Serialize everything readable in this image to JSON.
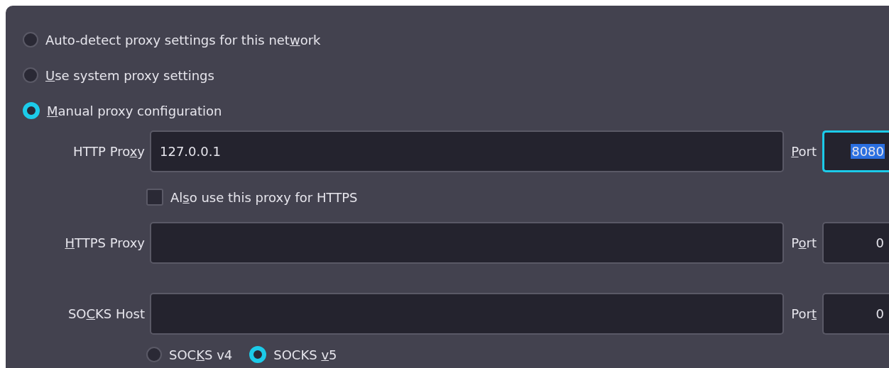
{
  "proxy_options": [
    {
      "label": {
        "before": "Auto-detect proxy settings for this net",
        "key": "w",
        "after": "ork"
      },
      "selected": false
    },
    {
      "label": {
        "key": "U",
        "after": "se system proxy settings"
      },
      "selected": false
    },
    {
      "label": {
        "key": "M",
        "after": "anual proxy configuration"
      },
      "selected": true
    }
  ],
  "http": {
    "label": {
      "before": "HTTP Pro",
      "key": "x",
      "after": "y"
    },
    "value": "127.0.0.1",
    "port_label": {
      "key": "P",
      "after": "ort"
    },
    "port": "8080",
    "port_focused": true,
    "port_text_selected": true
  },
  "also_https": {
    "label": {
      "before": "Al",
      "key": "s",
      "after": "o use this proxy for HTTPS"
    },
    "checked": false
  },
  "https": {
    "label": {
      "key": "H",
      "after": "TTPS Proxy"
    },
    "port_label": {
      "before": "P",
      "key": "o",
      "after": "rt"
    },
    "port": "0"
  },
  "socks": {
    "label": {
      "before": "SO",
      "key": "C",
      "after": "KS Host"
    },
    "port_label": {
      "before": "Por",
      "key": "t"
    },
    "port": "0"
  },
  "socks_versions": [
    {
      "label": {
        "before": "SOC",
        "key": "K",
        "after": "S v4"
      },
      "selected": false
    },
    {
      "label": {
        "before": "SOCKS ",
        "key": "v",
        "after": "5"
      },
      "selected": true
    }
  ]
}
